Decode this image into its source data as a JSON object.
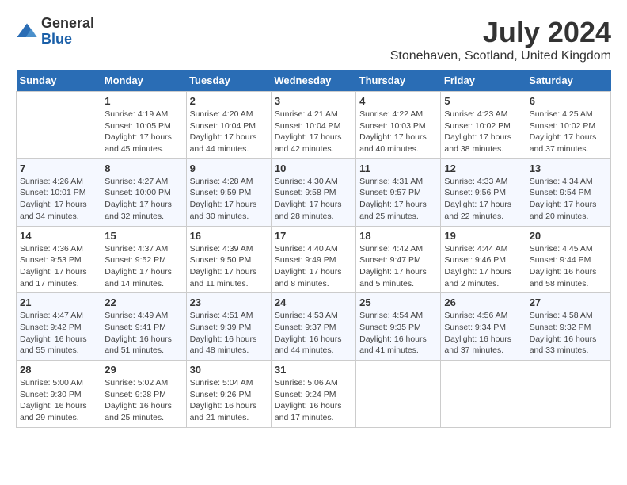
{
  "logo": {
    "general": "General",
    "blue": "Blue"
  },
  "title": "July 2024",
  "location": "Stonehaven, Scotland, United Kingdom",
  "days_of_week": [
    "Sunday",
    "Monday",
    "Tuesday",
    "Wednesday",
    "Thursday",
    "Friday",
    "Saturday"
  ],
  "weeks": [
    [
      {
        "num": "",
        "sunrise": "",
        "sunset": "",
        "daylight": ""
      },
      {
        "num": "1",
        "sunrise": "Sunrise: 4:19 AM",
        "sunset": "Sunset: 10:05 PM",
        "daylight": "Daylight: 17 hours and 45 minutes."
      },
      {
        "num": "2",
        "sunrise": "Sunrise: 4:20 AM",
        "sunset": "Sunset: 10:04 PM",
        "daylight": "Daylight: 17 hours and 44 minutes."
      },
      {
        "num": "3",
        "sunrise": "Sunrise: 4:21 AM",
        "sunset": "Sunset: 10:04 PM",
        "daylight": "Daylight: 17 hours and 42 minutes."
      },
      {
        "num": "4",
        "sunrise": "Sunrise: 4:22 AM",
        "sunset": "Sunset: 10:03 PM",
        "daylight": "Daylight: 17 hours and 40 minutes."
      },
      {
        "num": "5",
        "sunrise": "Sunrise: 4:23 AM",
        "sunset": "Sunset: 10:02 PM",
        "daylight": "Daylight: 17 hours and 38 minutes."
      },
      {
        "num": "6",
        "sunrise": "Sunrise: 4:25 AM",
        "sunset": "Sunset: 10:02 PM",
        "daylight": "Daylight: 17 hours and 37 minutes."
      }
    ],
    [
      {
        "num": "7",
        "sunrise": "Sunrise: 4:26 AM",
        "sunset": "Sunset: 10:01 PM",
        "daylight": "Daylight: 17 hours and 34 minutes."
      },
      {
        "num": "8",
        "sunrise": "Sunrise: 4:27 AM",
        "sunset": "Sunset: 10:00 PM",
        "daylight": "Daylight: 17 hours and 32 minutes."
      },
      {
        "num": "9",
        "sunrise": "Sunrise: 4:28 AM",
        "sunset": "Sunset: 9:59 PM",
        "daylight": "Daylight: 17 hours and 30 minutes."
      },
      {
        "num": "10",
        "sunrise": "Sunrise: 4:30 AM",
        "sunset": "Sunset: 9:58 PM",
        "daylight": "Daylight: 17 hours and 28 minutes."
      },
      {
        "num": "11",
        "sunrise": "Sunrise: 4:31 AM",
        "sunset": "Sunset: 9:57 PM",
        "daylight": "Daylight: 17 hours and 25 minutes."
      },
      {
        "num": "12",
        "sunrise": "Sunrise: 4:33 AM",
        "sunset": "Sunset: 9:56 PM",
        "daylight": "Daylight: 17 hours and 22 minutes."
      },
      {
        "num": "13",
        "sunrise": "Sunrise: 4:34 AM",
        "sunset": "Sunset: 9:54 PM",
        "daylight": "Daylight: 17 hours and 20 minutes."
      }
    ],
    [
      {
        "num": "14",
        "sunrise": "Sunrise: 4:36 AM",
        "sunset": "Sunset: 9:53 PM",
        "daylight": "Daylight: 17 hours and 17 minutes."
      },
      {
        "num": "15",
        "sunrise": "Sunrise: 4:37 AM",
        "sunset": "Sunset: 9:52 PM",
        "daylight": "Daylight: 17 hours and 14 minutes."
      },
      {
        "num": "16",
        "sunrise": "Sunrise: 4:39 AM",
        "sunset": "Sunset: 9:50 PM",
        "daylight": "Daylight: 17 hours and 11 minutes."
      },
      {
        "num": "17",
        "sunrise": "Sunrise: 4:40 AM",
        "sunset": "Sunset: 9:49 PM",
        "daylight": "Daylight: 17 hours and 8 minutes."
      },
      {
        "num": "18",
        "sunrise": "Sunrise: 4:42 AM",
        "sunset": "Sunset: 9:47 PM",
        "daylight": "Daylight: 17 hours and 5 minutes."
      },
      {
        "num": "19",
        "sunrise": "Sunrise: 4:44 AM",
        "sunset": "Sunset: 9:46 PM",
        "daylight": "Daylight: 17 hours and 2 minutes."
      },
      {
        "num": "20",
        "sunrise": "Sunrise: 4:45 AM",
        "sunset": "Sunset: 9:44 PM",
        "daylight": "Daylight: 16 hours and 58 minutes."
      }
    ],
    [
      {
        "num": "21",
        "sunrise": "Sunrise: 4:47 AM",
        "sunset": "Sunset: 9:42 PM",
        "daylight": "Daylight: 16 hours and 55 minutes."
      },
      {
        "num": "22",
        "sunrise": "Sunrise: 4:49 AM",
        "sunset": "Sunset: 9:41 PM",
        "daylight": "Daylight: 16 hours and 51 minutes."
      },
      {
        "num": "23",
        "sunrise": "Sunrise: 4:51 AM",
        "sunset": "Sunset: 9:39 PM",
        "daylight": "Daylight: 16 hours and 48 minutes."
      },
      {
        "num": "24",
        "sunrise": "Sunrise: 4:53 AM",
        "sunset": "Sunset: 9:37 PM",
        "daylight": "Daylight: 16 hours and 44 minutes."
      },
      {
        "num": "25",
        "sunrise": "Sunrise: 4:54 AM",
        "sunset": "Sunset: 9:35 PM",
        "daylight": "Daylight: 16 hours and 41 minutes."
      },
      {
        "num": "26",
        "sunrise": "Sunrise: 4:56 AM",
        "sunset": "Sunset: 9:34 PM",
        "daylight": "Daylight: 16 hours and 37 minutes."
      },
      {
        "num": "27",
        "sunrise": "Sunrise: 4:58 AM",
        "sunset": "Sunset: 9:32 PM",
        "daylight": "Daylight: 16 hours and 33 minutes."
      }
    ],
    [
      {
        "num": "28",
        "sunrise": "Sunrise: 5:00 AM",
        "sunset": "Sunset: 9:30 PM",
        "daylight": "Daylight: 16 hours and 29 minutes."
      },
      {
        "num": "29",
        "sunrise": "Sunrise: 5:02 AM",
        "sunset": "Sunset: 9:28 PM",
        "daylight": "Daylight: 16 hours and 25 minutes."
      },
      {
        "num": "30",
        "sunrise": "Sunrise: 5:04 AM",
        "sunset": "Sunset: 9:26 PM",
        "daylight": "Daylight: 16 hours and 21 minutes."
      },
      {
        "num": "31",
        "sunrise": "Sunrise: 5:06 AM",
        "sunset": "Sunset: 9:24 PM",
        "daylight": "Daylight: 16 hours and 17 minutes."
      },
      {
        "num": "",
        "sunrise": "",
        "sunset": "",
        "daylight": ""
      },
      {
        "num": "",
        "sunrise": "",
        "sunset": "",
        "daylight": ""
      },
      {
        "num": "",
        "sunrise": "",
        "sunset": "",
        "daylight": ""
      }
    ]
  ]
}
